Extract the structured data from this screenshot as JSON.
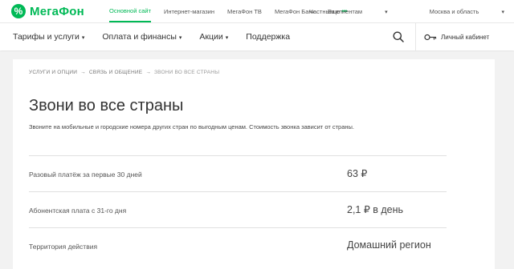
{
  "brand": {
    "logo_text": "МегаФон",
    "color": "#00b956"
  },
  "topbar": {
    "links": [
      {
        "label": "Основной сайт",
        "active": true
      },
      {
        "label": "Интернет-магазин",
        "active": false
      },
      {
        "label": "МегаФон ТВ",
        "active": false
      },
      {
        "label": "МегаФон Банк",
        "active": false
      }
    ],
    "more_label": "Еще",
    "more_dots": "•••",
    "clients": "Частным клиентам",
    "region": "Москва и область"
  },
  "mainnav": {
    "items": [
      {
        "label": "Тарифы и услуги",
        "dropdown": true
      },
      {
        "label": "Оплата и финансы",
        "dropdown": true
      },
      {
        "label": "Акции",
        "dropdown": true
      },
      {
        "label": "Поддержка",
        "dropdown": false
      }
    ],
    "cabinet_label": "Личный кабинет"
  },
  "breadcrumb": {
    "items": [
      "УСЛУГИ И ОПЦИИ",
      "СВЯЗЬ И ОБЩЕНИЕ",
      "ЗВОНИ ВО ВСЕ СТРАНЫ"
    ],
    "separator": "→"
  },
  "page": {
    "title": "Звони во все страны",
    "description": "Звоните на мобильные и городские номера других стран по выгодным ценам. Стоимость звонка зависит от страны."
  },
  "details": [
    {
      "label": "Разовый платёж за первые 30 дней",
      "value": "63 ₽"
    },
    {
      "label": "Абонентская плата с 31-го дня",
      "value": "2,1 ₽ в день"
    },
    {
      "label": "Территория действия",
      "value": "Домашний регион"
    }
  ]
}
